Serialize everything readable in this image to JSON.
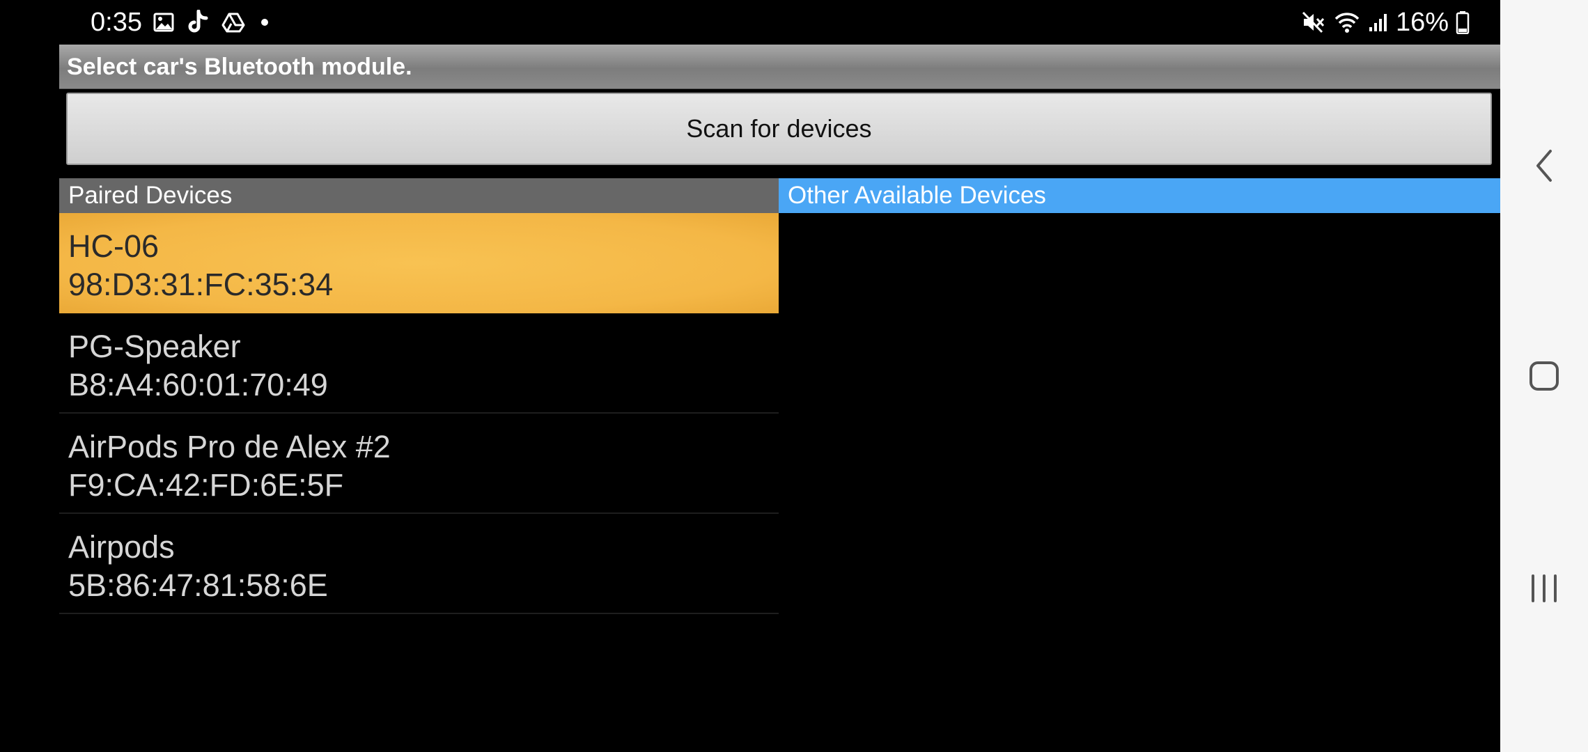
{
  "status_bar": {
    "time": "0:35",
    "battery": "16%",
    "left_icons": [
      "gallery-icon",
      "tiktok-icon",
      "drive-icon",
      "dot-icon"
    ],
    "right_icons": [
      "mute-icon",
      "wifi-icon",
      "signal-icon",
      "battery-icon"
    ]
  },
  "app": {
    "title": "Select car's Bluetooth module.",
    "scan_button_label": "Scan for devices"
  },
  "sections": {
    "paired_header": "Paired Devices",
    "other_header": "Other Available Devices"
  },
  "paired_devices": [
    {
      "name": "HC-06",
      "address": "98:D3:31:FC:35:34",
      "selected": true
    },
    {
      "name": "PG-Speaker",
      "address": "B8:A4:60:01:70:49",
      "selected": false
    },
    {
      "name": "AirPods Pro de Alex #2",
      "address": "F9:CA:42:FD:6E:5F",
      "selected": false
    },
    {
      "name": "Airpods",
      "address": "5B:86:47:81:58:6E",
      "selected": false
    }
  ],
  "other_devices": [],
  "nav_bar": {
    "buttons": [
      "back-icon",
      "home-icon",
      "recents-icon"
    ]
  },
  "colors": {
    "selected_row": "#f4b746",
    "paired_header": "#676767",
    "other_header": "#4aa6f5",
    "title_bar": "#8e8e8e"
  }
}
